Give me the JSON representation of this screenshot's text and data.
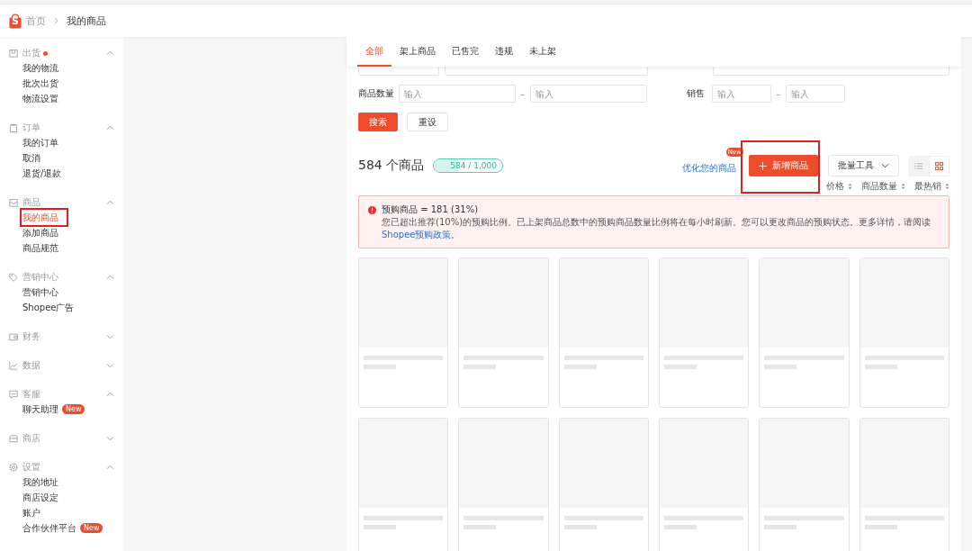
{
  "breadcrumb": {
    "logo": "S",
    "home": "首页",
    "current": "我的商品"
  },
  "sidebar": [
    {
      "title": "出货",
      "expanded": true,
      "alert": true,
      "items": [
        {
          "label": "我的物流",
          "selected": false
        },
        {
          "label": "批次出货",
          "selected": false
        },
        {
          "label": "物流设置",
          "selected": false
        }
      ]
    },
    {
      "title": "订单",
      "expanded": true,
      "items": [
        {
          "label": "我的订单",
          "selected": false
        },
        {
          "label": "取消",
          "selected": false
        },
        {
          "label": "退货/退款",
          "selected": false
        }
      ]
    },
    {
      "title": "商品",
      "expanded": true,
      "items": [
        {
          "label": "我的商品",
          "selected": true,
          "highlighted": true
        },
        {
          "label": "添加商品",
          "selected": false
        },
        {
          "label": "商品规范",
          "selected": false
        }
      ]
    },
    {
      "title": "营销中心",
      "expanded": true,
      "items": [
        {
          "label": "营销中心",
          "selected": false
        },
        {
          "label": "Shopee广告",
          "selected": false
        }
      ]
    },
    {
      "title": "财务",
      "expanded": false
    },
    {
      "title": "数据",
      "expanded": false
    },
    {
      "title": "客服",
      "expanded": true,
      "items": [
        {
          "label": "聊天助理",
          "selected": false,
          "badge": "New"
        }
      ]
    },
    {
      "title": "商店",
      "expanded": false
    },
    {
      "title": "设置",
      "expanded": true,
      "items": [
        {
          "label": "我的地址",
          "selected": false
        },
        {
          "label": "商店设定",
          "selected": false
        },
        {
          "label": "账户",
          "selected": false
        },
        {
          "label": "合作伙伴平台",
          "selected": false,
          "badge": "New"
        }
      ]
    }
  ],
  "tabs": [
    {
      "label": "全部",
      "selected": true
    },
    {
      "label": "架上商品",
      "selected": false
    },
    {
      "label": "已售完",
      "selected": false
    },
    {
      "label": "违规",
      "selected": false
    },
    {
      "label": "未上架",
      "selected": false
    }
  ],
  "filters": [
    {
      "label": "商品数量",
      "min_placeholder": "输入",
      "max_placeholder": "输入",
      "separator": "–"
    },
    {
      "label": "销售",
      "min_placeholder": "输入",
      "max_placeholder": "输入",
      "separator": "–"
    }
  ],
  "search_button": "搜索",
  "reset_button": "重设",
  "summary": {
    "count": "584 个商品",
    "quota": "584 / 1,000",
    "level": 0.35
  },
  "optimize_link": {
    "text": "优化您的商品",
    "badge": "New"
  },
  "add_button": {
    "label": "新增商品",
    "highlighted": true
  },
  "bulk_tools": "批量工具",
  "view_modes": [
    {
      "kind": "list",
      "selected": false
    },
    {
      "kind": "grid",
      "selected": true
    }
  ],
  "sort": [
    "价格",
    "商品数量",
    "最热销"
  ],
  "alert": {
    "title": "预购商品 = 181 (31%)",
    "message": "您已超出推荐(10%)的预购比例。已上架商品总数中的预购商品数量比例将在每小时刷新。您可以更改商品的预购状态。更多详情，请阅读",
    "link": "Shopee预购政策",
    "end": "。"
  },
  "products": [
    {
      "kind": "placeholder"
    },
    {
      "kind": "placeholder"
    },
    {
      "kind": "placeholder"
    },
    {
      "kind": "placeholder"
    },
    {
      "kind": "placeholder"
    },
    {
      "kind": "placeholder"
    },
    {
      "kind": "placeholder"
    },
    {
      "kind": "placeholder"
    },
    {
      "kind": "placeholder"
    },
    {
      "kind": "placeholder"
    },
    {
      "kind": "placeholder"
    },
    {
      "kind": "placeholder"
    }
  ]
}
